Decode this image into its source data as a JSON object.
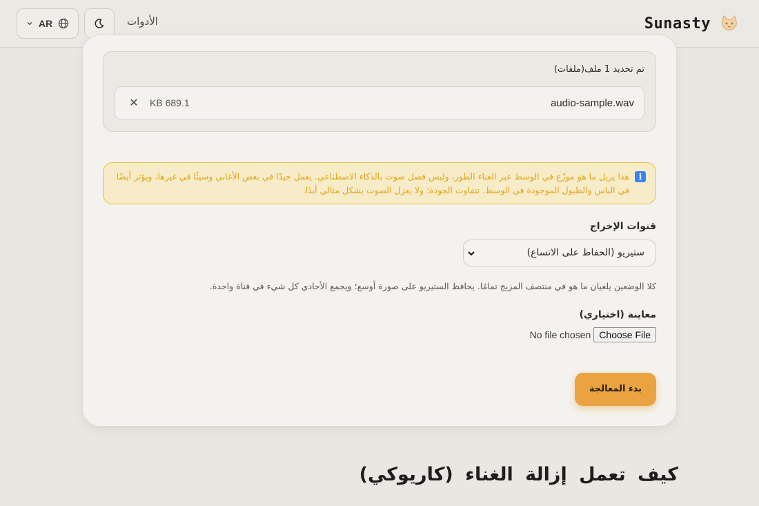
{
  "header": {
    "brand": "Sunasty",
    "brand_icon": "cat-logo-icon",
    "tools_label": "الأدوات",
    "lang_label": "AR",
    "theme_icon": "moon-icon"
  },
  "files": {
    "count_label": "تم تحديد 1 ملف(ملفات)",
    "items": [
      {
        "name": "audio-sample.wav",
        "size": "KB 689.1"
      }
    ]
  },
  "notice": {
    "icon": "info-icon",
    "text": "هذا يزيل ما هو موزّع في الوسط عبر الغناء الطور، وليس فصل صوت بالذكاء الاصطناعي. يعمل جيدًا في بعض الأغاني وسيئًا في غيرها، ويؤثر أيضًا في الباس والطبول الموجودة في الوسط. تتفاوت الجودة؛ ولا يعزل الصوت بشكل مثالي أبدًا."
  },
  "output_channels": {
    "label": "قنوات الإخراج",
    "selected": "ستيريو (الحفاظ على الاتساع)",
    "help": "كلا الوضعين يلغيان ما هو في منتصف المزيج تمامًا. يحافظ الستيريو على صورة أوسع؛ ويجمع الأحادي كل شيء في قناة واحدة."
  },
  "preview": {
    "label": "معاينة (اختياري)",
    "choose_label": "Choose File",
    "no_file_label": "No file chosen"
  },
  "start_button": "بدء المعالجة",
  "section_title": "كيف تعمل إزالة الغناء (كاريوكي)",
  "colors": {
    "accent": "#eaa341",
    "notice_bg": "#f7ecc8",
    "notice_border": "#e9bf3c",
    "notice_text": "#e0a41a"
  }
}
